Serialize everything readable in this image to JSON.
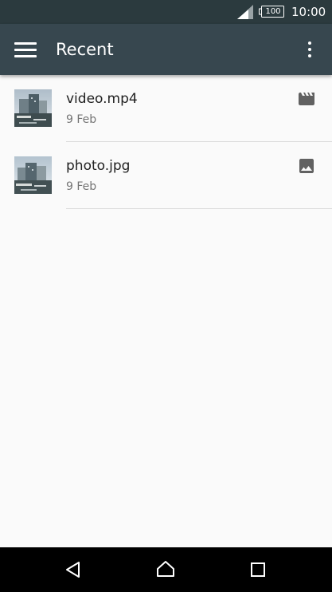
{
  "status_bar": {
    "battery_level": "100",
    "time": "10:00"
  },
  "app_bar": {
    "title": "Recent",
    "menu_icon": "hamburger-menu-icon",
    "overflow_icon": "more-vert-icon"
  },
  "files": [
    {
      "name": "video.mp4",
      "date": "9 Feb",
      "type_icon": "movie-clapper-icon"
    },
    {
      "name": "photo.jpg",
      "date": "9 Feb",
      "type_icon": "image-icon"
    }
  ],
  "nav_bar": {
    "back_icon": "back-triangle-icon",
    "home_icon": "home-icon",
    "recents_icon": "recents-square-icon"
  },
  "colors": {
    "status_bar": "#2b3a3e",
    "app_bar": "#37474f",
    "background": "#fafafa",
    "nav_bar": "#000000"
  }
}
